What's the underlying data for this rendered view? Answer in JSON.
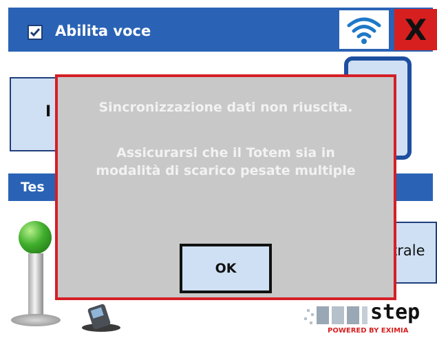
{
  "header": {
    "voice_label": "Abilita voce",
    "voice_checked": true,
    "wifi_icon": "wifi-icon",
    "close_label": "X"
  },
  "background": {
    "left_panel_label": "I",
    "band_label": "Tes",
    "right_panel_label": "trale"
  },
  "dialog": {
    "line1": "Sincronizzazione dati non riuscita.",
    "line2": "Assicurarsi che il Totem sia in",
    "line3": "modalità di scarico pesate multiple",
    "ok_label": "OK"
  },
  "logo": {
    "name": "step",
    "tagline": "POWERED BY EXIMIA"
  },
  "colors": {
    "accent_blue": "#2a63b5",
    "dialog_border": "#d41f26",
    "close_red": "#d71f1f"
  }
}
